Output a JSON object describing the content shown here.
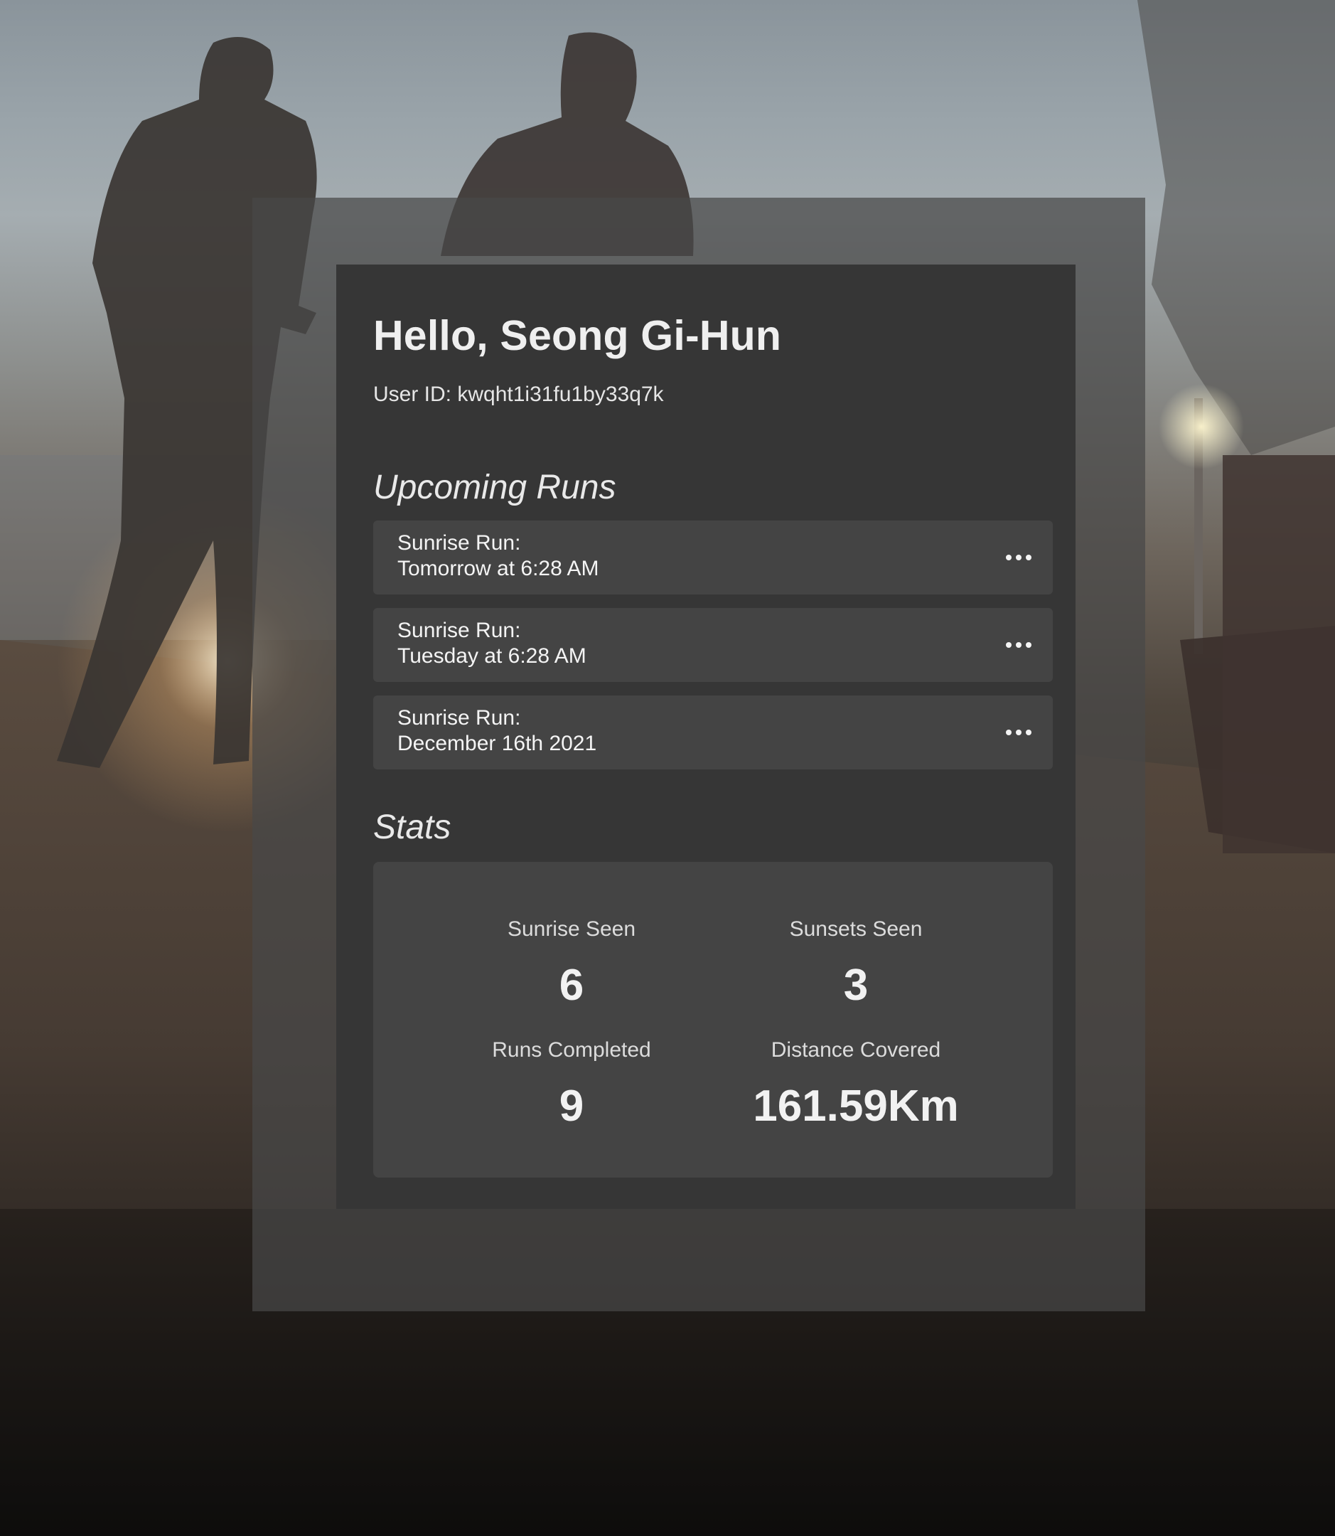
{
  "greeting": "Hello, Seong Gi-Hun",
  "user_id": "User ID: kwqht1i31fu1by33q7k",
  "upcoming": {
    "title": "Upcoming Runs",
    "runs": [
      {
        "name": "Sunrise Run:",
        "time": "Tomorrow at 6:28 AM",
        "more_icon": "more-horizontal-icon"
      },
      {
        "name": "Sunrise Run:",
        "time": "Tuesday at 6:28 AM",
        "more_icon": "more-horizontal-icon"
      },
      {
        "name": "Sunrise Run:",
        "time": "December 16th 2021",
        "more_icon": "more-horizontal-icon"
      }
    ]
  },
  "stats": {
    "title": "Stats",
    "items": [
      {
        "label": "Sunrise Seen",
        "value": "6"
      },
      {
        "label": "Sunsets Seen",
        "value": "3"
      },
      {
        "label": "Runs Completed",
        "value": "9"
      },
      {
        "label": "Distance Covered",
        "value": "161.59Km"
      }
    ]
  },
  "colors": {
    "card_bg": "#363636",
    "item_bg": "#444444",
    "outer_panel": "#484848",
    "text": "#f2f2f2"
  }
}
